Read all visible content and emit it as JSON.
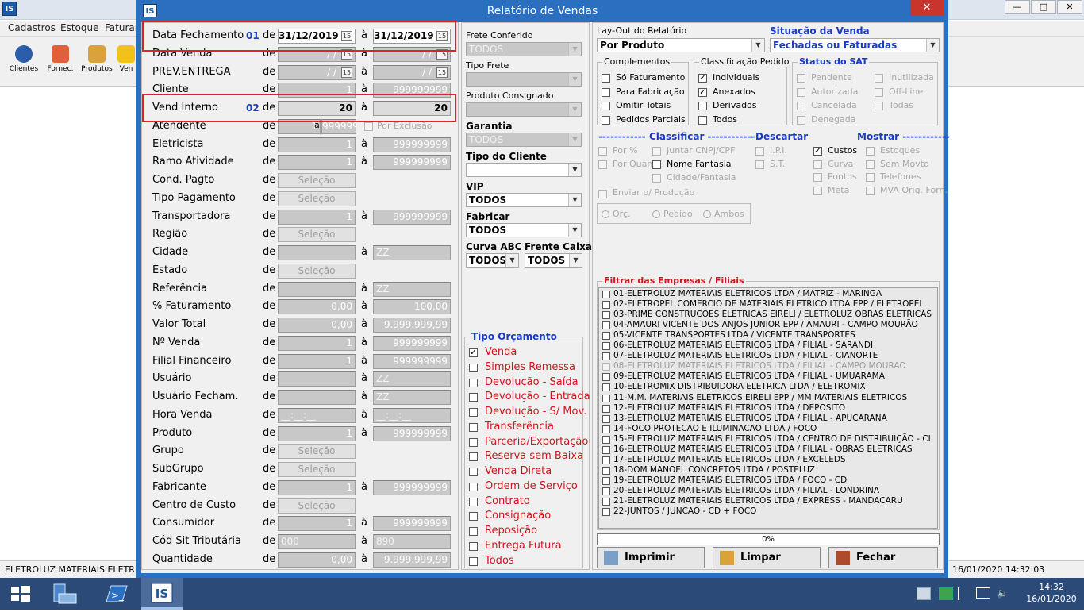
{
  "background_app": {
    "icon_text": "IS",
    "menu": [
      "Cadastros",
      "Estoque",
      "Faturam"
    ],
    "toolbar": [
      "Clientes",
      "Fornec.",
      "Produtos",
      "Ven"
    ],
    "status_left": "ELETROLUZ MATERIAIS ELETR",
    "status_right": "16/01/2020 14:32:03",
    "window_controls": [
      "—",
      "□",
      "✕"
    ]
  },
  "taskbar": {
    "clock_time": "14:32",
    "clock_date": "16/01/2020",
    "active_app_label": "IS"
  },
  "dialog": {
    "title": "Relatório de Vendas",
    "icon_text": "IS",
    "close": "✕"
  },
  "filters": {
    "de": "de",
    "a": "à",
    "rows": [
      {
        "label": "Data Fechamento",
        "num": "01",
        "from": "31/12/2019",
        "to": "31/12/2019",
        "kind": "date",
        "active": true
      },
      {
        "label": "Data Venda",
        "num": "",
        "from": " /  / ",
        "to": " /  / ",
        "kind": "date"
      },
      {
        "label": "PREV.ENTREGA",
        "num": "",
        "from": " /  / ",
        "to": " /  / ",
        "kind": "date"
      },
      {
        "label": "Cliente",
        "num": "",
        "from": "1",
        "to": "999999999",
        "kind": "range"
      },
      {
        "label": "Vend Interno",
        "num": "02",
        "from": "20",
        "to": "20",
        "kind": "range",
        "active": true
      },
      {
        "label": "Atendente",
        "num": "",
        "from": "1",
        "to": "999999",
        "kind": "atendente",
        "excl": "Por Exclusão"
      },
      {
        "label": "Eletricista",
        "num": "",
        "from": "1",
        "to": "999999999",
        "kind": "range"
      },
      {
        "label": "Ramo Atividade",
        "num": "",
        "from": "1",
        "to": "999999999",
        "kind": "range"
      },
      {
        "label": "Cond. Pagto",
        "num": "",
        "sel": "Seleção",
        "kind": "sel"
      },
      {
        "label": "Tipo Pagamento",
        "num": "",
        "sel": "Seleção",
        "kind": "sel"
      },
      {
        "label": "Transportadora",
        "num": "",
        "from": "1",
        "to": "999999999",
        "kind": "range"
      },
      {
        "label": "Região",
        "num": "",
        "sel": "Seleção",
        "kind": "sel"
      },
      {
        "label": "Cidade",
        "num": "",
        "from": "",
        "to": "ZZ",
        "kind": "text"
      },
      {
        "label": "Estado",
        "num": "",
        "sel": "Seleção",
        "kind": "sel"
      },
      {
        "label": "Referência",
        "num": "",
        "from": "",
        "to": "ZZ",
        "kind": "text"
      },
      {
        "label": "% Faturamento",
        "num": "",
        "from": "0,00",
        "to": "100,00",
        "kind": "range"
      },
      {
        "label": "Valor Total",
        "num": "",
        "from": "0,00",
        "to": "9.999.999,99",
        "kind": "range"
      },
      {
        "label": "Nº Venda",
        "num": "",
        "from": "1",
        "to": "999999999",
        "kind": "range"
      },
      {
        "label": "Filial Financeiro",
        "num": "",
        "from": "1",
        "to": "999999999",
        "kind": "range"
      },
      {
        "label": "Usuário",
        "num": "",
        "from": "",
        "to": "ZZ",
        "kind": "text"
      },
      {
        "label": "Usuário Fecham.",
        "num": "",
        "from": "",
        "to": "ZZ",
        "kind": "text"
      },
      {
        "label": "Hora Venda",
        "num": "",
        "from": "__:__:__",
        "to": "__:__:__",
        "kind": "text"
      },
      {
        "label": "Produto",
        "num": "",
        "from": "1",
        "to": "999999999",
        "kind": "range"
      },
      {
        "label": "Grupo",
        "num": "",
        "sel": "Seleção",
        "kind": "sel"
      },
      {
        "label": "SubGrupo",
        "num": "",
        "sel": "Seleção",
        "kind": "sel"
      },
      {
        "label": "Fabricante",
        "num": "",
        "from": "1",
        "to": "999999999",
        "kind": "range"
      },
      {
        "label": "Centro de Custo",
        "num": "",
        "sel": "Seleção",
        "kind": "sel"
      },
      {
        "label": "Consumidor",
        "num": "",
        "from": "1",
        "to": "999999999",
        "kind": "range"
      },
      {
        "label": "Cód Sit Tributária",
        "num": "",
        "from": "000",
        "to": "890",
        "kind": "text"
      },
      {
        "label": "Quantidade",
        "num": "",
        "from": "0,00",
        "to": "9.999.999,99",
        "kind": "range"
      }
    ]
  },
  "middle": {
    "frete_conferido": {
      "label": "Frete Conferido",
      "value": "TODOS"
    },
    "tipo_frete": {
      "label": "Tipo Frete",
      "value": ""
    },
    "produto_consignado": {
      "label": "Produto Consignado",
      "value": ""
    },
    "garantia": {
      "label": "Garantia",
      "value": "TODOS"
    },
    "tipo_cliente": {
      "label": "Tipo do Cliente",
      "value": ""
    },
    "vip": {
      "label": "VIP",
      "value": "TODOS"
    },
    "fabricar": {
      "label": "Fabricar",
      "value": "TODOS"
    },
    "curva_abc": {
      "label": "Curva ABC",
      "value": "TODOS"
    },
    "frente_caixa": {
      "label": "Frente Caixa",
      "value": "TODOS"
    },
    "tipo_orcamento": {
      "title": "Tipo Orçamento",
      "items": [
        {
          "label": "Venda",
          "checked": true
        },
        {
          "label": "Simples Remessa",
          "checked": false
        },
        {
          "label": "Devolução - Saída",
          "checked": false
        },
        {
          "label": "Devolução - Entrada",
          "checked": false
        },
        {
          "label": "Devolução - S/ Mov.",
          "checked": false
        },
        {
          "label": "Transferência",
          "checked": false
        },
        {
          "label": "Parceria/Exportação",
          "checked": false
        },
        {
          "label": "Reserva sem Baixa",
          "checked": false
        },
        {
          "label": "Venda Direta",
          "checked": false
        },
        {
          "label": "Ordem de Serviço",
          "checked": false
        },
        {
          "label": "Contrato",
          "checked": false
        },
        {
          "label": "Consignação",
          "checked": false
        },
        {
          "label": "Reposição",
          "checked": false
        },
        {
          "label": "Entrega Futura",
          "checked": false
        },
        {
          "label": "Todos",
          "checked": false
        }
      ]
    }
  },
  "right": {
    "layout": {
      "label": "Lay-Out do Relatório",
      "value": "Por Produto"
    },
    "situacao": {
      "label": "Situação da Venda",
      "value": "Fechadas ou Faturadas"
    },
    "complementos": {
      "title": "Complementos",
      "items": [
        "Só Faturamento",
        "Para Fabricação",
        "Omitir Totais",
        "Pedidos Parciais"
      ]
    },
    "classificacao": {
      "title": "Classificação Pedido",
      "items": [
        {
          "label": "Individuais",
          "checked": true
        },
        {
          "label": "Anexados",
          "checked": true
        },
        {
          "label": "Derivados",
          "checked": false
        },
        {
          "label": "Todos",
          "checked": false
        }
      ]
    },
    "status_sat": {
      "title": "Status do SAT",
      "col1": [
        "Pendente",
        "Autorizada",
        "Cancelada",
        "Denegada"
      ],
      "col2": [
        "Inutilizada",
        "Off-Line",
        "Todas"
      ]
    },
    "classificar": {
      "title": "------------ Classificar ------------",
      "items": [
        "Por %",
        "Juntar CNPJ/CPF",
        "Por Quant.",
        "Nome Fantasia",
        "Cidade/Fantasia"
      ]
    },
    "descartar": {
      "title": "Descartar",
      "items": [
        "I.P.I.",
        "S.T."
      ]
    },
    "mostrar": {
      "title": "Mostrar ------------",
      "col1": [
        {
          "label": "Custos",
          "checked": true,
          "enabled": true
        },
        {
          "label": "Curva",
          "checked": false
        },
        {
          "label": "Pontos",
          "checked": false
        },
        {
          "label": "Meta",
          "checked": false
        }
      ],
      "col2": [
        "Estoques",
        "Sem Movto",
        "Telefones",
        "MVA Orig. Forn."
      ]
    },
    "enviar": "Enviar p/ Produção",
    "radios": [
      "Orç.",
      "Pedido",
      "Ambos"
    ],
    "empresas": {
      "title": "Filtrar das Empresas / Filiais",
      "items": [
        "01-ELETROLUZ MATERIAIS ELETRICOS LTDA / MATRIZ - MARINGA",
        "02-ELETROPEL COMERCIO DE MATERIAIS ELETRICO LTDA EPP / ELETROPEL",
        "03-PRIME CONSTRUCOES ELETRICAS EIRELI / ELETROLUZ OBRAS ELETRICAS",
        "04-AMAURI VICENTE DOS ANJOS JUNIOR EPP / AMAURI - CAMPO MOURÃO",
        "05-VICENTE TRANSPORTES LTDA / VICENTE TRANSPORTES",
        "06-ELETROLUZ MATERIAIS ELETRICOS LTDA / FILIAL - SARANDI",
        "07-ELETROLUZ MATERIAIS ELETRICOS LTDA / FILIAL - CIANORTE",
        "08-ELETROLUZ MATERIAIS ELETRICOS LTDA / FILIAL - CAMPO MOURAO",
        "09-ELETROLUZ MATERIAIS ELETRICOS LTDA / FILIAL - UMUARAMA",
        "10-ELETROMIX DISTRIBUIDORA ELETRICA LTDA / ELETROMIX",
        "11-M.M. MATERIAIS ELETRICOS EIRELI EPP / MM MATERIAIS ELETRICOS",
        "12-ELETROLUZ MATERIAIS ELETRICOS LTDA / DEPOSITO",
        "13-ELETROLUZ MATERIAIS ELETRICOS LTDA / FILIAL - APUCARANA",
        "14-FOCO PROTECAO E ILUMINACAO LTDA / FOCO",
        "15-ELETROLUZ MATERIAIS ELETRICOS LTDA  / CENTRO DE DISTRIBUIÇÃO - CI",
        "16-ELETROLUZ MATERIAIS ELETRICOS LTDA / FILIAL - OBRAS ELETRICAS",
        "17-ELETROLUZ MATERIAIS ELETRICOS LTDA / EXCELEDS",
        "18-DOM MANOEL CONCRETOS LTDA / POSTELUZ",
        "19-ELETROLUZ MATERIAIS ELETRICOS LTDA / FOCO - CD",
        "20-ELETROLUZ MATERIAIS ELETRICOS LTDA  / FILIAL - LONDRINA",
        "21-ELETROLUZ MATERIAIS ELETRICOS LTDA / EXPRESS - MANDACARU",
        "22-JUNTOS / JUNCAO - CD + FOCO"
      ]
    },
    "progress": "0%",
    "buttons": {
      "imprimir": "Imprimir",
      "limpar": "Limpar",
      "fechar": "Fechar"
    }
  }
}
